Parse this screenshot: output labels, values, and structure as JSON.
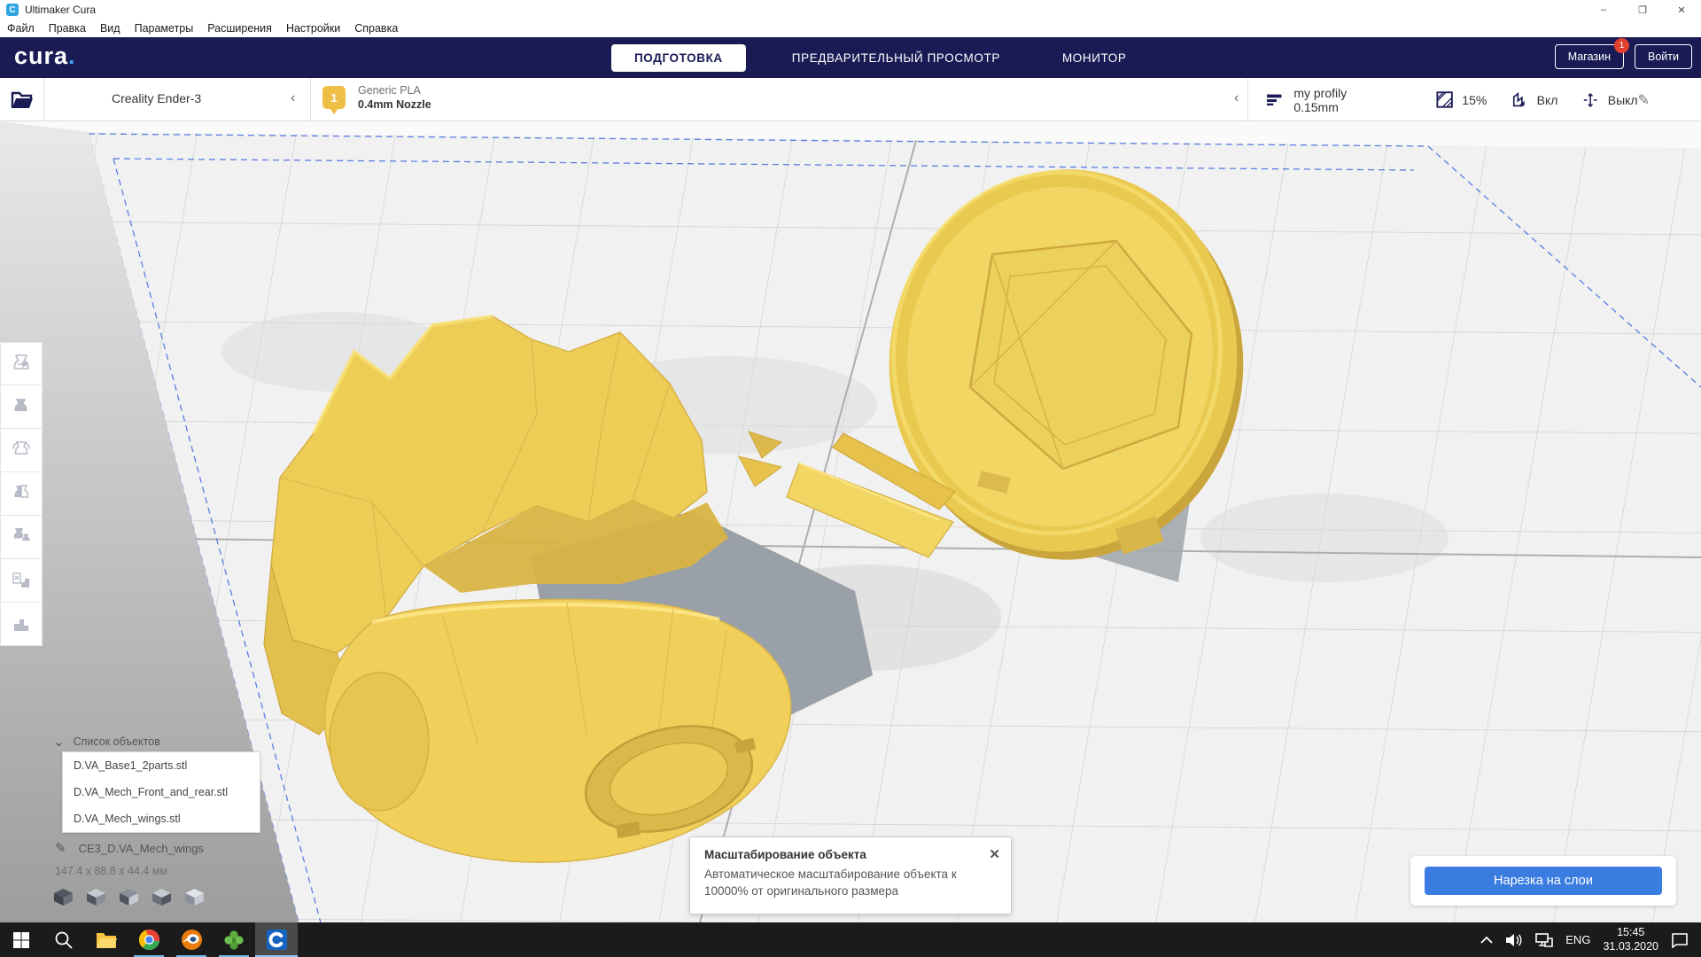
{
  "titlebar": {
    "app_icon_letter": "C",
    "title": "Ultimaker Cura",
    "minimize": "–",
    "restore": "❐",
    "close": "✕"
  },
  "menubar": {
    "items": [
      "Файл",
      "Правка",
      "Вид",
      "Параметры",
      "Расширения",
      "Настройки",
      "Справка"
    ]
  },
  "topbar": {
    "logo_text": "cura",
    "logo_dot": ".",
    "tabs": [
      {
        "label": "ПОДГОТОВКА"
      },
      {
        "label": "ПРЕДВАРИТЕЛЬНЫЙ ПРОСМОТР"
      },
      {
        "label": "МОНИТОР"
      }
    ],
    "active_tab": "ПОДГОТОВКА",
    "marketplace_label": "Магазин",
    "marketplace_badge": "1",
    "signin_label": "Войти"
  },
  "configbar": {
    "printer_name": "Creality Ender-3",
    "collapse_chevron": "‹",
    "material": {
      "extruder_index": "1",
      "name": "Generic PLA",
      "nozzle": "0.4mm Nozzle"
    },
    "settings": {
      "profile": "my profily 0.15mm",
      "infill_percent": "15%",
      "support_state": "Вкл",
      "adhesion_state": "Выкл",
      "edit_icon": "✎"
    }
  },
  "object_panel": {
    "header": "Список объектов",
    "chevron": "⌄",
    "files": [
      "D.VA_Base1_2parts.stl",
      "D.VA_Mech_Front_and_rear.stl",
      "D.VA_Mech_wings.stl"
    ],
    "selected_name": "CE3_D.VA_Mech_wings",
    "selected_dimensions": "147.4 x 88.8 x 44.4 мм",
    "edit_icon": "✎"
  },
  "notification": {
    "title": "Масштабирование объекта",
    "message": "Автоматическое масштабирование объекта к 10000% от оригинального размера",
    "close": "✕"
  },
  "slice_panel": {
    "button_label": "Нарезка на слои"
  },
  "taskbar": {
    "language": "ENG",
    "time": "15:45",
    "date": "31.03.2020"
  },
  "colors": {
    "navy": "#1a1b55",
    "accent_blue": "#3b7ce1",
    "model_yellow": "#f0cf5b",
    "badge_red": "#e23f2e",
    "material_badge": "#eebf47",
    "plate_grid": "#cfcfcf"
  }
}
